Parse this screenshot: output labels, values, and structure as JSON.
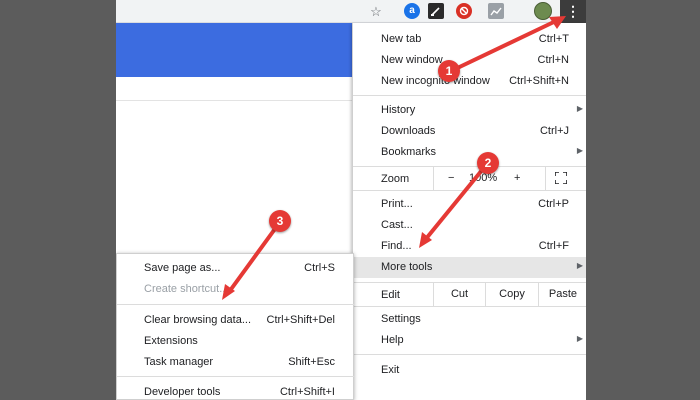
{
  "menu": {
    "items_top": [
      {
        "label": "New tab",
        "shortcut": "Ctrl+T"
      },
      {
        "label": "New window",
        "shortcut": "Ctrl+N"
      },
      {
        "label": "New incognito window",
        "shortcut": "Ctrl+Shift+N"
      }
    ],
    "history": "History",
    "downloads": {
      "label": "Downloads",
      "shortcut": "Ctrl+J"
    },
    "bookmarks": "Bookmarks",
    "zoom": {
      "label": "Zoom",
      "minus": "−",
      "value": "100%",
      "plus": "+"
    },
    "print": {
      "label": "Print...",
      "shortcut": "Ctrl+P"
    },
    "cast": "Cast...",
    "find": {
      "label": "Find...",
      "shortcut": "Ctrl+F"
    },
    "more_tools": "More tools",
    "edit": {
      "label": "Edit",
      "cut": "Cut",
      "copy": "Copy",
      "paste": "Paste"
    },
    "settings": "Settings",
    "help": "Help",
    "exit": "Exit"
  },
  "submenu": {
    "save_page": {
      "label": "Save page as...",
      "shortcut": "Ctrl+S"
    },
    "create_shortcut": "Create shortcut...",
    "clear_browsing": {
      "label": "Clear browsing data...",
      "shortcut": "Ctrl+Shift+Del"
    },
    "extensions": "Extensions",
    "task_manager": {
      "label": "Task manager",
      "shortcut": "Shift+Esc"
    },
    "developer_tools": {
      "label": "Developer tools",
      "shortcut": "Ctrl+Shift+I"
    }
  },
  "toolbar": {
    "star_glyph": "☆",
    "ext_a_glyph": "a",
    "kebab_glyph": "⋮"
  },
  "annotations": [
    "1",
    "2",
    "3"
  ],
  "colors": {
    "accent_blue": "#3c6ce0",
    "arrow_red": "#e53935",
    "highlight": "#e6e6e6"
  }
}
